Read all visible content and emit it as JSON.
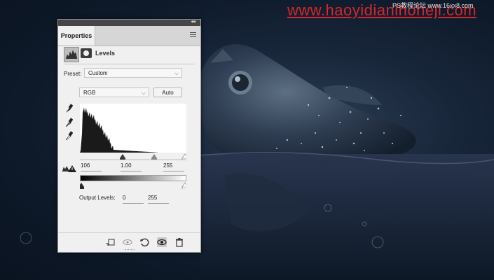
{
  "watermark": {
    "main": "www.haoyidianlhoheji.com",
    "sub": "PS教程论坛 www.16xx8.com"
  },
  "panel": {
    "tab_label": "Properties",
    "collapse_glyph": "◂◂",
    "adjustment_title": "Levels",
    "preset": {
      "label": "Preset:",
      "value": "Custom"
    },
    "channel": {
      "value": "RGB"
    },
    "auto_label": "Auto",
    "input_levels": {
      "black": "106",
      "gamma": "1.00",
      "white": "255"
    },
    "output_levels": {
      "label": "Output Levels:",
      "black": "0",
      "white": "255"
    },
    "histogram_color": "#1a1a1a",
    "icons": [
      "levels-histogram-icon",
      "layer-mask-icon",
      "black-point-eyedropper-icon",
      "gray-point-eyedropper-icon",
      "white-point-eyedropper-icon",
      "clip-to-layer-icon",
      "view-previous-state-icon",
      "reset-icon",
      "visibility-eye-icon",
      "trash-icon",
      "clipping-warning-icon",
      "panel-menu-icon"
    ]
  }
}
